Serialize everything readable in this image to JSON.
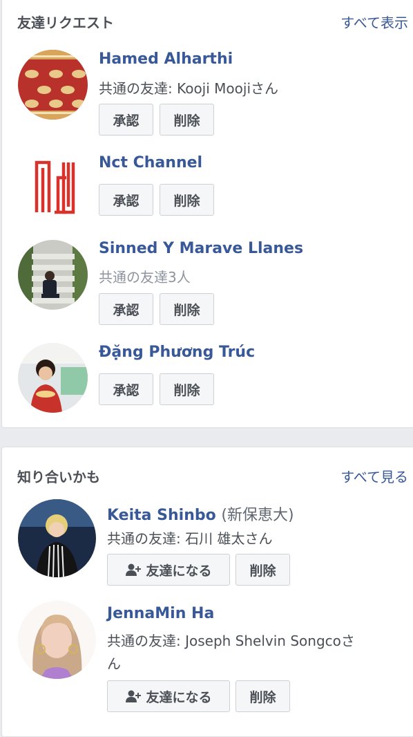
{
  "friend_requests": {
    "title": "友達リクエスト",
    "see_all": "すべて表示",
    "confirm_label": "承認",
    "delete_label": "削除",
    "items": [
      {
        "name": "Hamed Alharthi",
        "mutual": "共通の友達: Kooji Moojiさん",
        "avatar": "carpet-pattern-avatar"
      },
      {
        "name": "Nct Channel",
        "mutual": "",
        "avatar": "nct-logo-avatar"
      },
      {
        "name": "Sinned Y Marave Llanes",
        "mutual": "共通の友達3人",
        "avatar": "person-on-stairs-avatar"
      },
      {
        "name": "Đặng Phương Trúc",
        "mutual": "",
        "avatar": "person-eating-avatar"
      }
    ]
  },
  "people_you_may_know": {
    "title": "知り合いかも",
    "see_all": "すべて見る",
    "add_friend_label": "友達になる",
    "delete_label": "削除",
    "items": [
      {
        "name": "Keita Shinbo",
        "alt_name": "(新保恵大)",
        "mutual": "共通の友達: 石川 雄太さん",
        "avatar": "keita-avatar"
      },
      {
        "name": "JennaMin Ha",
        "alt_name": "",
        "mutual": "共通の友達: Joseph Shelvin Songcoさ",
        "mutual_line2": "ん",
        "avatar": "jennamin-avatar"
      }
    ]
  },
  "colors": {
    "link": "#385898",
    "page_bg": "#e9ebee",
    "button_bg": "#f5f6f7"
  }
}
